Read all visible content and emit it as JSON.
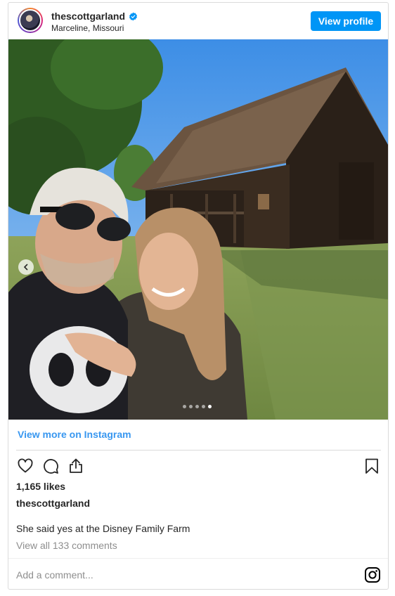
{
  "header": {
    "username": "thescottgarland",
    "location": "Marceline, Missouri",
    "view_profile_label": "View profile"
  },
  "post": {
    "photo_alt": "",
    "carousel_total": 5,
    "carousel_active": 5
  },
  "links": {
    "view_more": "View more on Instagram"
  },
  "stats": {
    "likes": "1,165 likes"
  },
  "caption": {
    "username": "thescottgarland",
    "text": "She said yes at the Disney Family Farm"
  },
  "comments": {
    "view_all": "View all 133 comments",
    "add_placeholder": "Add a comment..."
  },
  "colors": {
    "accent": "#0095f6",
    "link": "#3897f0",
    "muted": "#8e8e8e",
    "border": "#dbdbdb"
  },
  "icons": {
    "like": "heart-icon",
    "comment": "comment-icon",
    "share": "share-icon",
    "save": "bookmark-icon",
    "verified": "verified-badge-icon",
    "instagram": "instagram-logo-icon",
    "carousel_prev": "chevron-left-icon"
  }
}
